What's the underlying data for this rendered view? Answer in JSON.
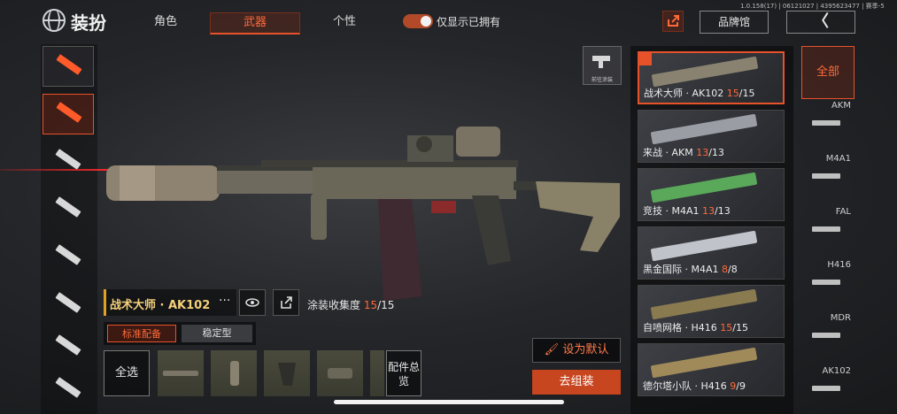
{
  "header": {
    "title": "装扮",
    "tabs": [
      {
        "label": "角色",
        "active": false
      },
      {
        "label": "武器",
        "active": true
      },
      {
        "label": "个性",
        "active": false
      }
    ],
    "toggle_label": "仅显示已拥有",
    "toggle_on": true,
    "version": "1.0.158(17) | 06121027 | 4395623477 | 赛季-5",
    "brand_label": "品牌馆",
    "back_label": "〈"
  },
  "weapon": {
    "name": "战术大师 · AK102",
    "more": "···",
    "collection_label": "涂装收集度",
    "collection_current": "15",
    "collection_total": "/15"
  },
  "loadout": {
    "tabs": [
      {
        "label": "标准配备",
        "active": true
      },
      {
        "label": "稳定型",
        "active": false
      }
    ],
    "select_all": "全选",
    "summary_label": "配件总览"
  },
  "actions": {
    "set_default": "设为默认",
    "go_assemble": "去组装",
    "paint_label": "前往涂装"
  },
  "skins": [
    {
      "name": "战术大师 · AK102 ",
      "owned": "15",
      "total": "/15",
      "selected": true,
      "color": "#8a8270"
    },
    {
      "name": "来战 · AKM ",
      "owned": "13",
      "total": "/13",
      "selected": false,
      "color": "#9a9ea4"
    },
    {
      "name": "竞技 · M4A1 ",
      "owned": "13",
      "total": "/13",
      "selected": false,
      "color": "#5aa85a"
    },
    {
      "name": "黑金国际 · M4A1 ",
      "owned": "8",
      "total": "/8",
      "selected": false,
      "color": "#c0c4ca"
    },
    {
      "name": "自喷网格 · H416 ",
      "owned": "15",
      "total": "/15",
      "selected": false,
      "color": "#8a7a50"
    },
    {
      "name": "德尔塔小队 · H416 ",
      "owned": "9",
      "total": "/9",
      "selected": false,
      "color": "#a08a5a"
    }
  ],
  "filters": {
    "all_label": "全部",
    "items": [
      "AKM",
      "M4A1",
      "FAL",
      "H416",
      "MDR",
      "AK102"
    ]
  },
  "colors": {
    "accent": "#e8522a",
    "highlight": "#ff6a3a",
    "name": "#f3d07a"
  }
}
